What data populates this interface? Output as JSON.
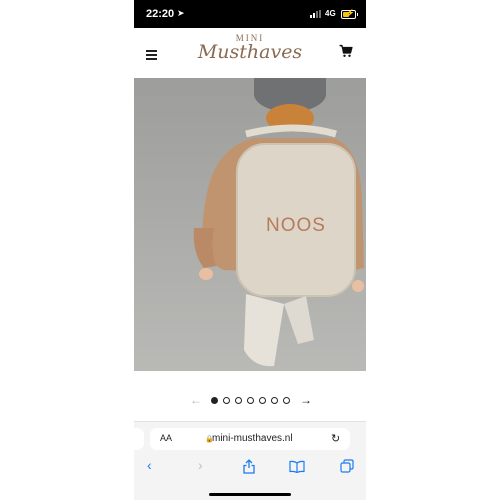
{
  "status_bar": {
    "time": "22:20",
    "location_arrow": "location-arrow-icon",
    "network": "4G",
    "battery_level": 0.5,
    "battery_charging": true
  },
  "header": {
    "logo_top": "MINI",
    "logo_bottom": "Musthaves",
    "menu_icon": "hamburger-menu-icon",
    "cart_icon": "shopping-cart-icon",
    "brand_color": "#8a6b52"
  },
  "product_image": {
    "subject": "child-with-teddy-backpack",
    "backpack_text": "NOOS"
  },
  "carousel": {
    "prev_arrow": "←",
    "next_arrow": "→",
    "dot_count": 7,
    "active_index": 0
  },
  "browser": {
    "text_size_label": "AA",
    "url": "mini-musthaves.nl",
    "reload_icon": "reload-icon",
    "accent": "#1a7cf5",
    "toolbar": [
      {
        "icon": "back-icon",
        "glyph": "‹"
      },
      {
        "icon": "forward-icon",
        "glyph": "›"
      },
      {
        "icon": "share-icon"
      },
      {
        "icon": "bookmarks-icon"
      },
      {
        "icon": "tabs-icon"
      }
    ]
  }
}
